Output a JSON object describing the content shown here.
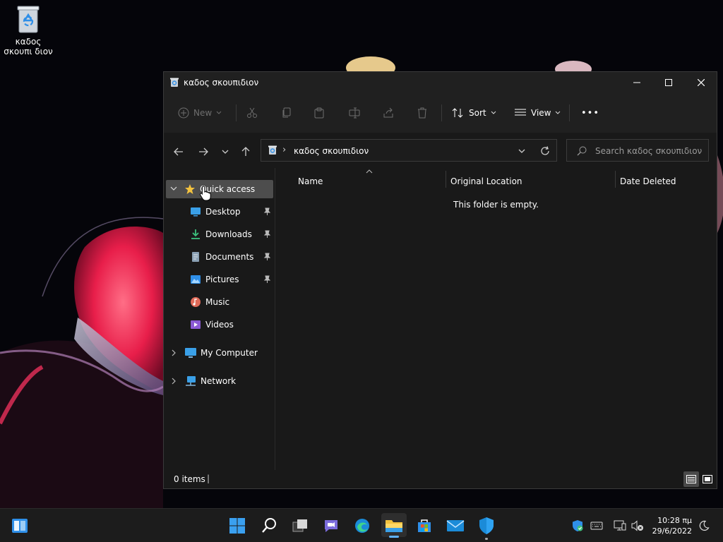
{
  "desktop": {
    "recycle_bin_label": "καδος σκουπι διον"
  },
  "window": {
    "title": "καδος σκουπιδιον",
    "controls": {
      "minimize": "minimize-icon",
      "maximize": "maximize-icon",
      "close": "close-icon"
    }
  },
  "commandbar": {
    "new_label": "New",
    "sort_label": "Sort",
    "view_label": "View",
    "more_label": "•••"
  },
  "address": {
    "separator": "›",
    "location": "καδος σκουπιδιον",
    "search_placeholder": "Search καδος σκουπιδιον"
  },
  "nav": {
    "quick_access": "Quick access",
    "items": [
      {
        "label": "Desktop"
      },
      {
        "label": "Downloads"
      },
      {
        "label": "Documents"
      },
      {
        "label": "Pictures"
      },
      {
        "label": "Music"
      },
      {
        "label": "Videos"
      }
    ],
    "my_computer": "My Computer",
    "network": "Network"
  },
  "content": {
    "columns": [
      "Name",
      "Original Location",
      "Date Deleted"
    ],
    "empty_message": "This folder is empty."
  },
  "status": {
    "items_count": "0 items",
    "cursor": "|"
  },
  "taskbar": {
    "time": "10:28 πμ",
    "date": "29/6/2022"
  },
  "colors": {
    "window_bg": "#191919",
    "titlebar_bg": "#202020",
    "selection_bg": "#4d4d4d",
    "accent_blue": "#2f8fe8",
    "folder_yellow": "#f3c23f"
  }
}
